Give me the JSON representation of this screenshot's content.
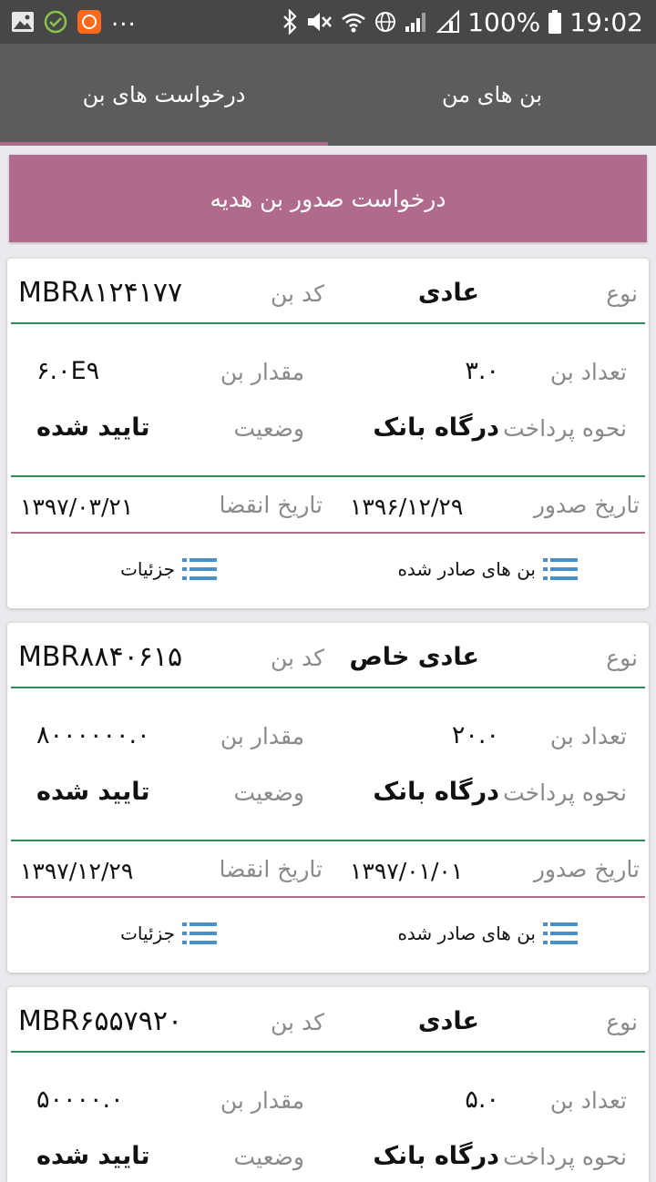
{
  "status_bar": {
    "battery": "100%",
    "time": "19:02",
    "more": "..."
  },
  "tabs": [
    {
      "label": "درخواست های بن",
      "active": true
    },
    {
      "label": "بن های من",
      "active": false
    }
  ],
  "gift_request_button": "درخواست صدور بن هدیه",
  "labels": {
    "type": "نوع",
    "code": "کد بن",
    "count": "تعداد بن",
    "amount": "مقدار بن",
    "payment_method": "نحوه پرداخت",
    "status": "وضعیت",
    "issue_date": "تاریخ صدور",
    "expiry_date": "تاریخ انقضا",
    "issued_coupons": "بن های صادر شده",
    "details": "جزئیات"
  },
  "cards": [
    {
      "type": "عادی",
      "code": "MBR۸۱۲۴۱۷۷",
      "count": "۳.۰",
      "amount": "۶.۰E۹",
      "payment_method": "درگاه بانک",
      "status": "تایید شده",
      "issue_date": "۱۳۹۶/۱۲/۲۹",
      "expiry_date": "۱۳۹۷/۰۳/۲۱"
    },
    {
      "type": "عادی خاص",
      "code": "MBR۸۸۴۰۶۱۵",
      "count": "۲۰.۰",
      "amount": "۸۰۰۰۰۰۰.۰",
      "payment_method": "درگاه بانک",
      "status": "تایید شده",
      "issue_date": "۱۳۹۷/۰۱/۰۱",
      "expiry_date": "۱۳۹۷/۱۲/۲۹"
    },
    {
      "type": "عادی",
      "code": "MBR۶۵۵۷۹۲۰",
      "count": "۵.۰",
      "amount": "۵۰۰۰۰.۰",
      "payment_method": "درگاه بانک",
      "status": "تایید شده"
    }
  ],
  "colors": {
    "accent": "#b06b8c",
    "divider_green": "#2e8b57",
    "icon_blue": "#4a90c8",
    "tabbar": "#5c5c5c",
    "statusbar": "#474747"
  }
}
